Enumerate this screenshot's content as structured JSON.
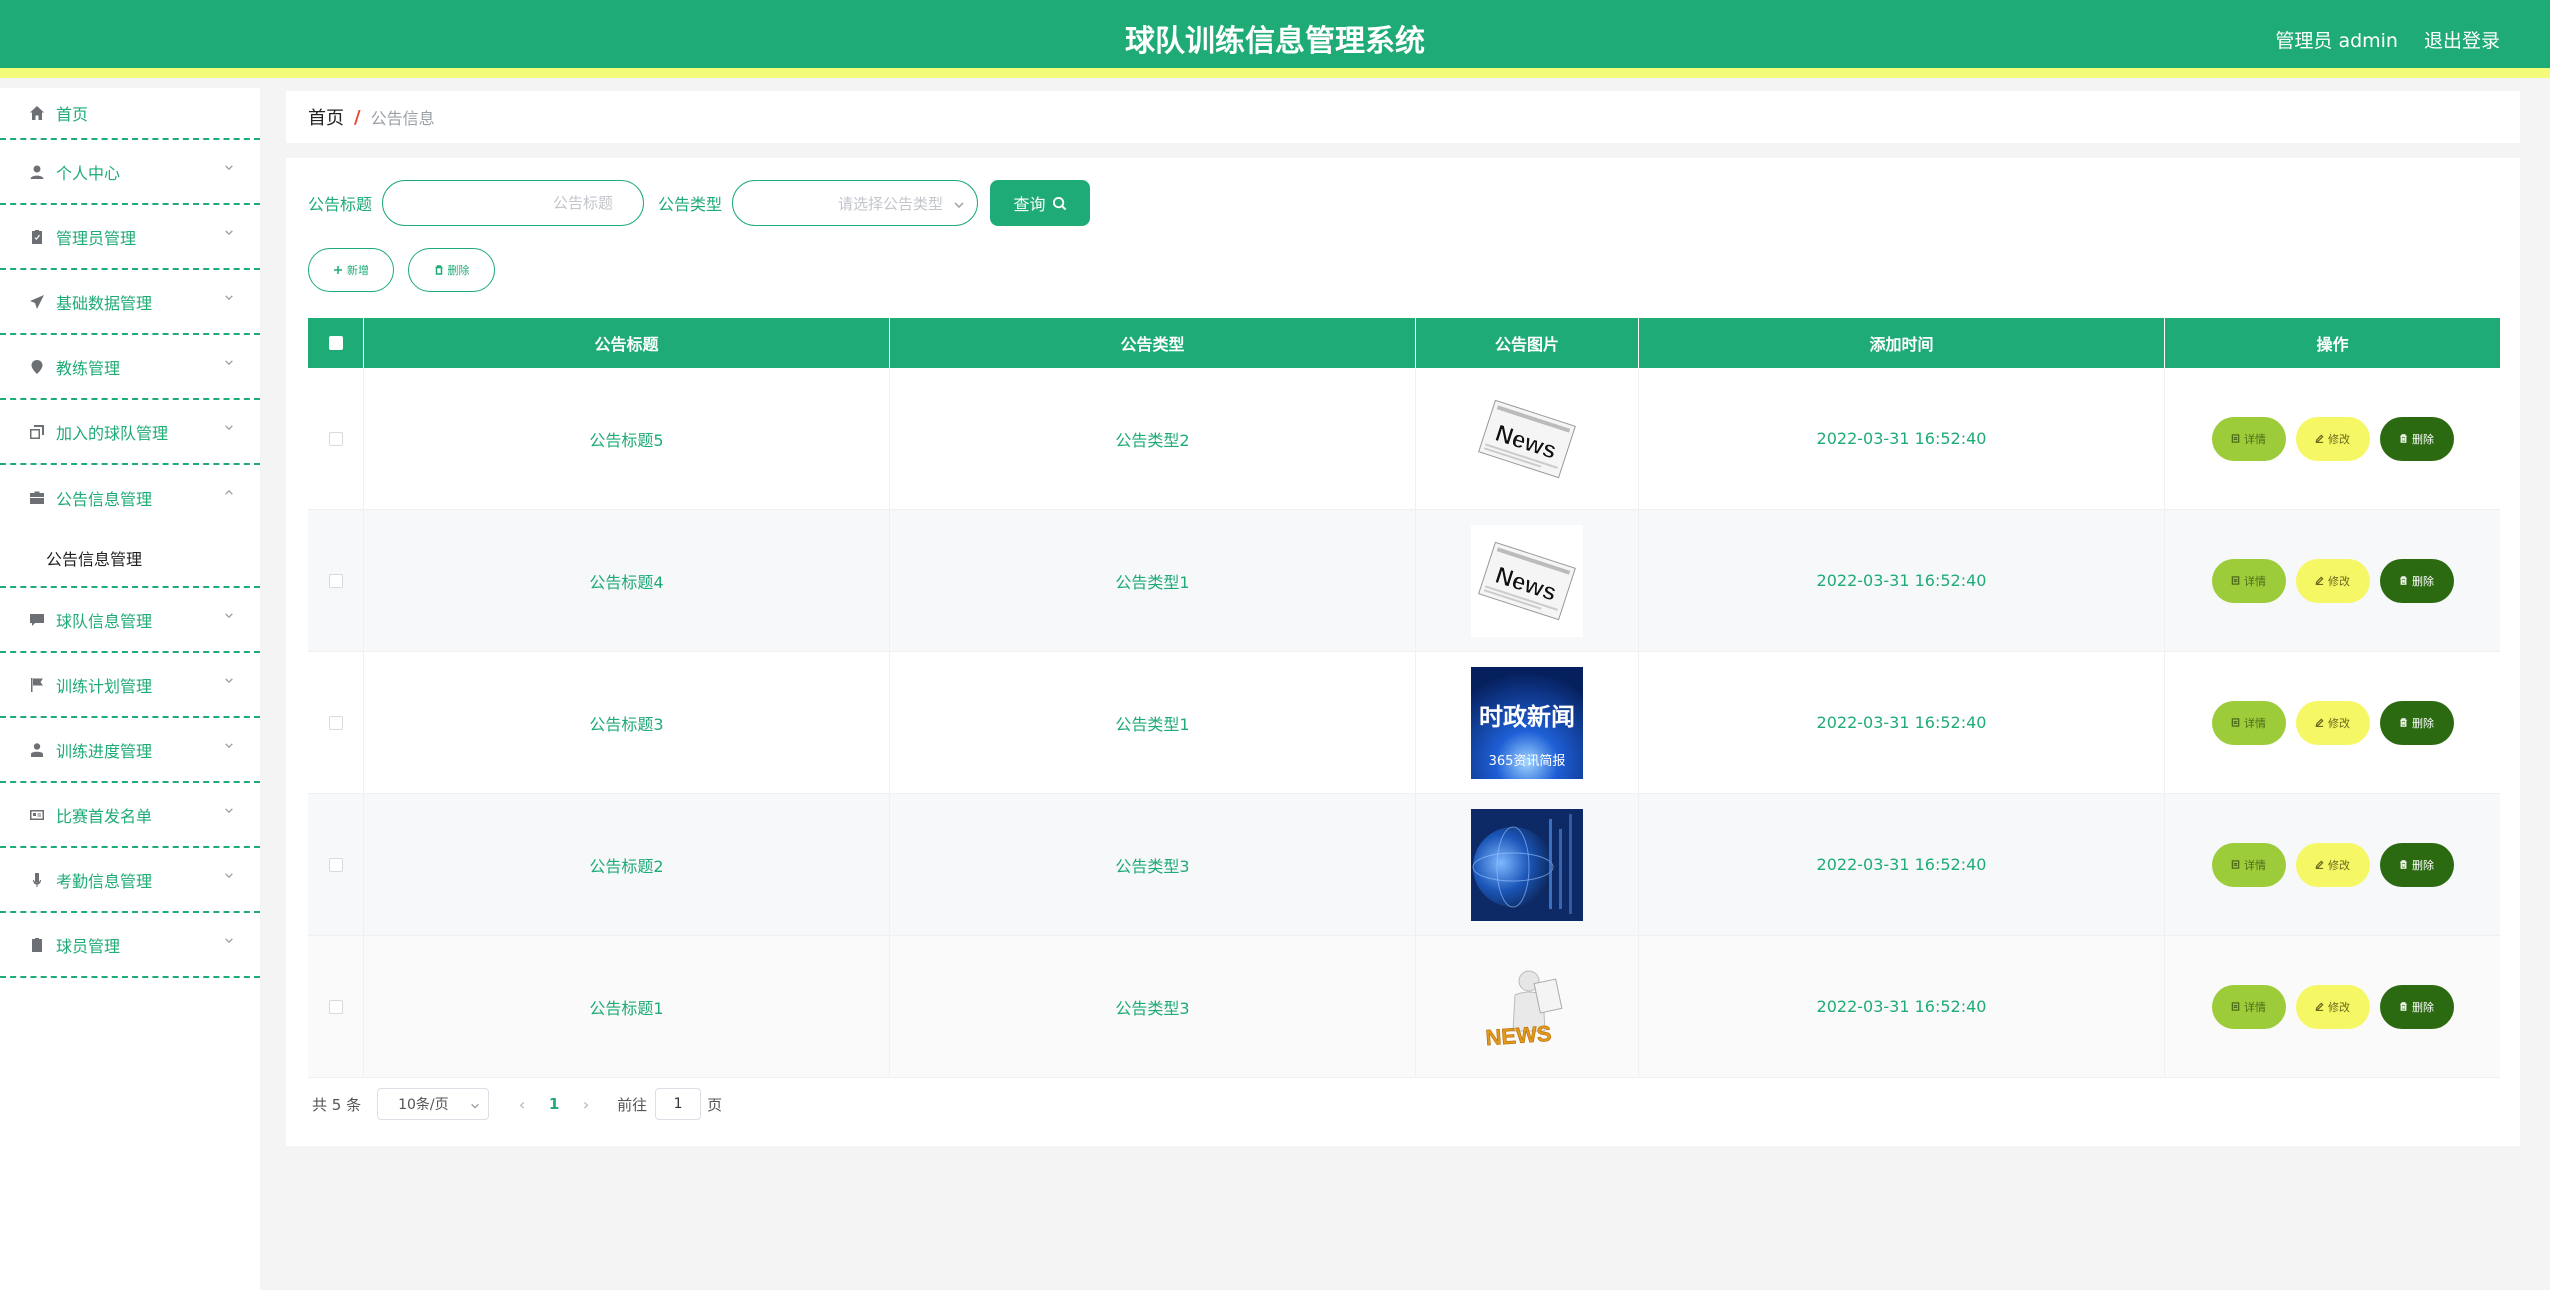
{
  "header": {
    "title": "球队训练信息管理系统",
    "user": "管理员 admin",
    "logout": "退出登录"
  },
  "sidebar": {
    "items": [
      {
        "label": "首页",
        "icon": "home-icon"
      },
      {
        "label": "个人中心",
        "icon": "user-icon"
      },
      {
        "label": "管理员管理",
        "icon": "clipboard-icon"
      },
      {
        "label": "基础数据管理",
        "icon": "send-icon"
      },
      {
        "label": "教练管理",
        "icon": "location-icon"
      },
      {
        "label": "加入的球队管理",
        "icon": "copy-icon"
      },
      {
        "label": "公告信息管理",
        "icon": "briefcase-icon"
      },
      {
        "label": "球队信息管理",
        "icon": "chat-icon"
      },
      {
        "label": "训练计划管理",
        "icon": "flag-icon"
      },
      {
        "label": "训练进度管理",
        "icon": "person-icon"
      },
      {
        "label": "比赛首发名单",
        "icon": "card-icon"
      },
      {
        "label": "考勤信息管理",
        "icon": "mic-icon"
      },
      {
        "label": "球员管理",
        "icon": "clipboard-icon"
      }
    ],
    "submenu": "公告信息管理"
  },
  "breadcrumb": {
    "home": "首页",
    "separator": "/",
    "current": "公告信息"
  },
  "search": {
    "title_label": "公告标题",
    "title_placeholder": "公告标题",
    "type_label": "公告类型",
    "type_placeholder": "请选择公告类型",
    "query_button": "查询"
  },
  "actions": {
    "add": "新增",
    "delete": "删除"
  },
  "table": {
    "headers": [
      "公告标题",
      "公告类型",
      "公告图片",
      "添加时间",
      "操作"
    ],
    "rows": [
      {
        "title": "公告标题5",
        "type": "公告类型2",
        "image": "news-newspaper",
        "time": "2022-03-31 16:52:40"
      },
      {
        "title": "公告标题4",
        "type": "公告类型1",
        "image": "news-newspaper",
        "time": "2022-03-31 16:52:40"
      },
      {
        "title": "公告标题3",
        "type": "公告类型1",
        "image": "时政新闻 365资讯简报",
        "time": "2022-03-31 16:52:40"
      },
      {
        "title": "公告标题2",
        "type": "公告类型3",
        "image": "globe-tech",
        "time": "2022-03-31 16:52:40"
      },
      {
        "title": "公告标题1",
        "type": "公告类型3",
        "image": "news-figure",
        "time": "2022-03-31 16:52:40"
      }
    ],
    "ops": {
      "detail": "详情",
      "edit": "修改",
      "delete": "删除"
    }
  },
  "pagination": {
    "total": "共 5 条",
    "page_size": "10条/页",
    "current_page": "1",
    "goto": "前往",
    "goto_value": "1",
    "page_suffix": "页"
  },
  "colors": {
    "primary": "#1fab76",
    "header_stripe": "#f3fb79",
    "detail_btn": "#9ccc3a",
    "edit_btn": "#f5f765",
    "delete_btn": "#2b6a10"
  }
}
